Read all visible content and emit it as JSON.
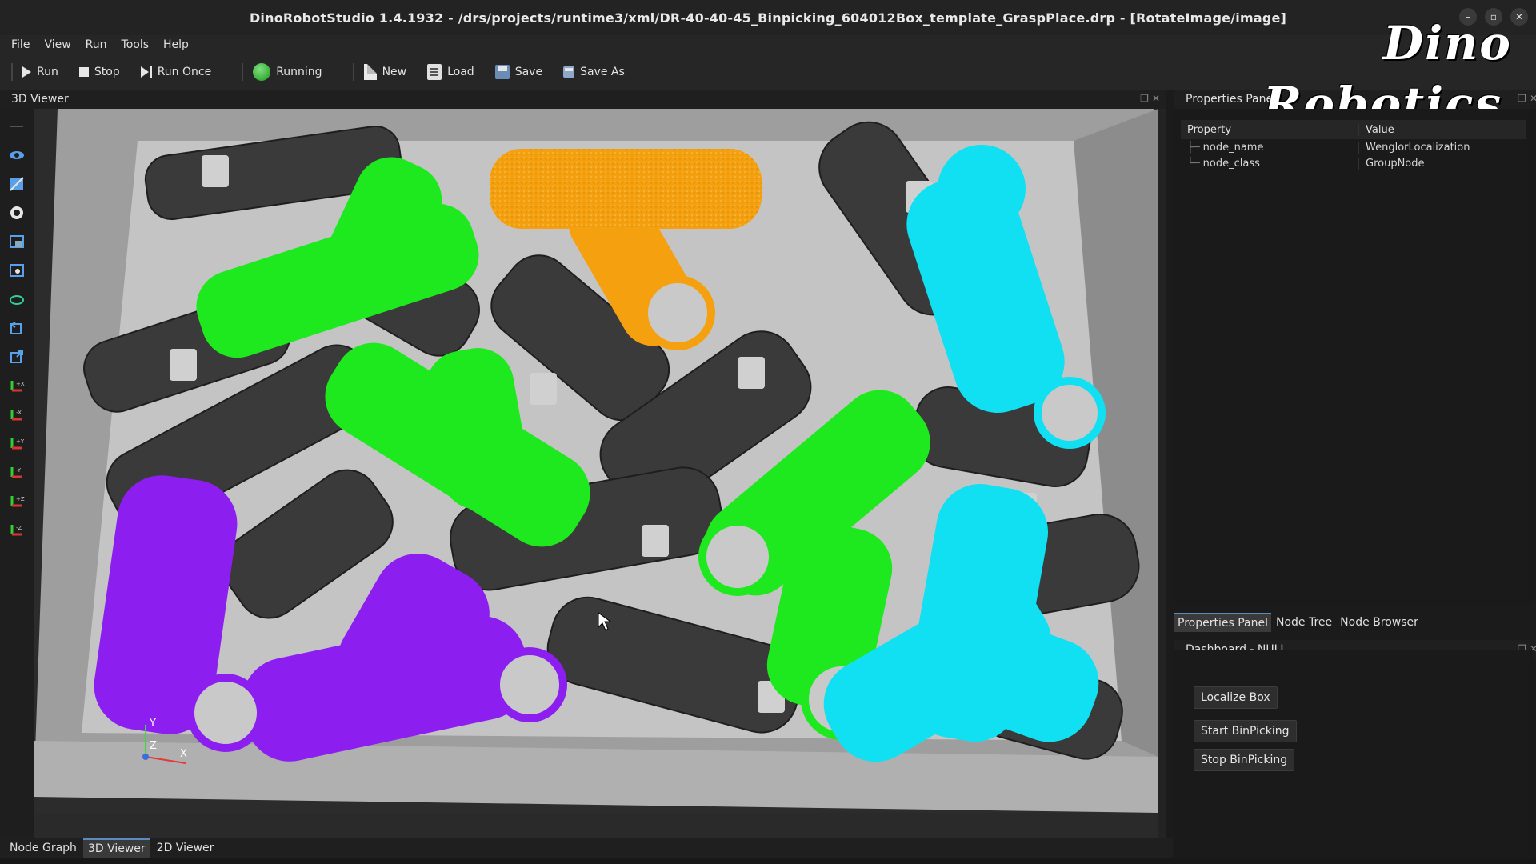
{
  "window": {
    "title": "DinoRobotStudio 1.4.1932 - /drs/projects/runtime3/xml/DR-40-40-45_Binpicking_604012Box_template_GraspPlace.drp - [RotateImage/image]"
  },
  "branding": {
    "line1": "Dino",
    "line2": "Robotics"
  },
  "menu": {
    "file": "File",
    "view": "View",
    "run": "Run",
    "tools": "Tools",
    "help": "Help"
  },
  "toolbar": {
    "run": "Run",
    "stop": "Stop",
    "run_once": "Run Once",
    "running": "Running",
    "new": "New",
    "load": "Load",
    "save": "Save",
    "save_as": "Save As"
  },
  "viewer": {
    "title": "3D Viewer",
    "axes": {
      "x": "X",
      "y": "Y",
      "z": "Z"
    }
  },
  "bottom_tabs": [
    "Node Graph",
    "3D Viewer",
    "2D Viewer"
  ],
  "properties": {
    "title": "Properties Panel",
    "col_property": "Property",
    "col_value": "Value",
    "rows": [
      {
        "key": "node_name",
        "value": "WenglorLocalization"
      },
      {
        "key": "node_class",
        "value": "GroupNode"
      }
    ]
  },
  "right_tabs": [
    "Properties Panel",
    "Node Tree",
    "Node Browser"
  ],
  "dashboard": {
    "title": "Dashboard - NULL",
    "buttons": [
      "Localize Box",
      "Start BinPicking",
      "Stop BinPicking"
    ]
  },
  "colors": {
    "green_part": "#1ee81e",
    "orange_part": "#f5a10f",
    "cyan_part": "#10e0f2",
    "purple_part": "#8c1ef0",
    "dark_part": "#3a3a3a",
    "bin_floor": "#bdbdbd"
  }
}
